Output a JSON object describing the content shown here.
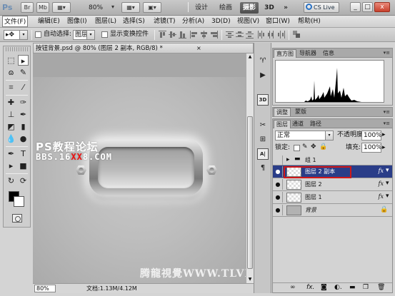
{
  "titlebar": {
    "logo": "Ps",
    "br_label": "Br",
    "mb_label": "Mb",
    "zoom": "80%",
    "workspaces": [
      "设计",
      "绘画",
      "摄影",
      "3D"
    ],
    "more": "»",
    "cslive": "CS Live",
    "window_buttons": [
      "_",
      "□",
      "x"
    ]
  },
  "menubar": {
    "items": [
      "文件(F)",
      "编辑(E)",
      "图像(I)",
      "图层(L)",
      "选择(S)",
      "滤镜(T)",
      "分析(A)",
      "3D(D)",
      "视图(V)",
      "窗口(W)",
      "帮助(H)"
    ]
  },
  "options": {
    "auto_select_label": "自动选择:",
    "auto_select_value": "图层",
    "show_transform_label": "显示变换控件"
  },
  "document": {
    "tab_title": "按钮背景.psd @ 80% (图层 2 副本, RGB/8) *",
    "tab_close": "×",
    "zoom": "80%",
    "doc_info": "文档:1.13M/4.12M",
    "watermark_top": "PS教程论坛",
    "watermark_bbs_a": "BBS.16",
    "watermark_bbs_b": "XX",
    "watermark_bbs_c": "8.COM",
    "watermark_bottom": "腾龍視覺WWW.TLVI.NET"
  },
  "histogram_panel": {
    "tabs": [
      "直方图",
      "导航器",
      "信息"
    ]
  },
  "adjust_panel": {
    "tabs": [
      "调整",
      "蒙版"
    ]
  },
  "layers_panel": {
    "tabs": [
      "图层",
      "通道",
      "路径"
    ],
    "blend_mode": "正常",
    "opacity_label": "不透明度:",
    "opacity_value": "100%",
    "lock_label": "锁定:",
    "fill_label": "填充:",
    "fill_value": "100%",
    "layers": [
      {
        "name": "组 1",
        "kind": "group",
        "visible": false,
        "fx": false,
        "selected": false
      },
      {
        "name": "图层 2 副本",
        "kind": "layer",
        "visible": true,
        "fx": true,
        "selected": true
      },
      {
        "name": "图层 2",
        "kind": "layer",
        "visible": true,
        "fx": true,
        "selected": false
      },
      {
        "name": "图层 1",
        "kind": "layer",
        "visible": true,
        "fx": true,
        "selected": false
      },
      {
        "name": "背景",
        "kind": "background",
        "visible": true,
        "fx": false,
        "selected": false
      }
    ],
    "fx_symbol": "fx",
    "bottom_icons": [
      "link-icon",
      "fx-icon",
      "mask-icon",
      "adjustment-icon",
      "folder-icon",
      "new-layer-icon",
      "trash-icon"
    ]
  },
  "colors": {
    "selected_layer": "#2a3d88",
    "highlight_box": "#d01818",
    "canvas": "#a7a7a7"
  }
}
